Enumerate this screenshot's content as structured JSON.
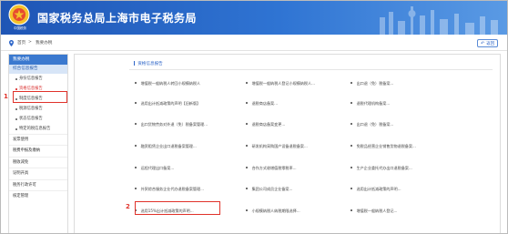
{
  "header": {
    "title": "国家税务总局上海市电子税务局",
    "emblem_text": "中国税务"
  },
  "breadcrumb": {
    "home": "首页",
    "separator": ">",
    "current": "我要办税",
    "back_label": "返回"
  },
  "sidebar": {
    "heading": "我要办税",
    "group": "综合信息报告",
    "items": [
      {
        "label": "身份信息报告",
        "active": false
      },
      {
        "label": "资格信息报告",
        "active": true
      },
      {
        "label": "制度信息报告",
        "active": false
      },
      {
        "label": "税源信息报告",
        "active": false
      },
      {
        "label": "状态信息报告",
        "active": false
      },
      {
        "label": "特定的税信息报告",
        "active": false
      }
    ],
    "top_items": [
      "发票使用",
      "税费申报及缴纳",
      "税收减免",
      "证明开具",
      "税务行政许可",
      "核定管理"
    ]
  },
  "main": {
    "section_title": "资格信息报告",
    "rows": [
      [
        "增值税一般纳税人转回小规模纳税人",
        "增值税一般纳税人登记小规模纳税人...",
        "出口退（免）税备案..."
      ],
      [
        "选用出计抵减政策的声明【旧新版】",
        "退税商店备案...",
        "退税代理机构备案..."
      ],
      [
        "出口货物劳务对外退（免）税备案管理...",
        "退税商店备案变更...",
        "出口退（免）税备案..."
      ],
      [
        "融资租赁企业出口退税备案管理...",
        "研发机构采购国产设备退税备案...",
        "免税品经营企业销售货物退税备案..."
      ],
      [
        "远程代理出口备案...",
        "合作方式收增值税零税率...",
        "生产企业委托代办出口退税备案..."
      ],
      [
        "外贸综合服务企业代办退税备案管理...",
        "集团公司成员企业备案...",
        "选用出计抵减政策的声明..."
      ],
      [
        "选用15%出计抵减政策的声明...",
        "小规模纳税人纳税期限选择...",
        "增值税一般纳税人登记..."
      ]
    ]
  },
  "annotations": {
    "marker1": "1",
    "marker2": "2"
  },
  "colors": {
    "header_blue": "#2f74d3",
    "sidebar_head": "#3b79cf",
    "highlight_red": "#e0322a"
  }
}
